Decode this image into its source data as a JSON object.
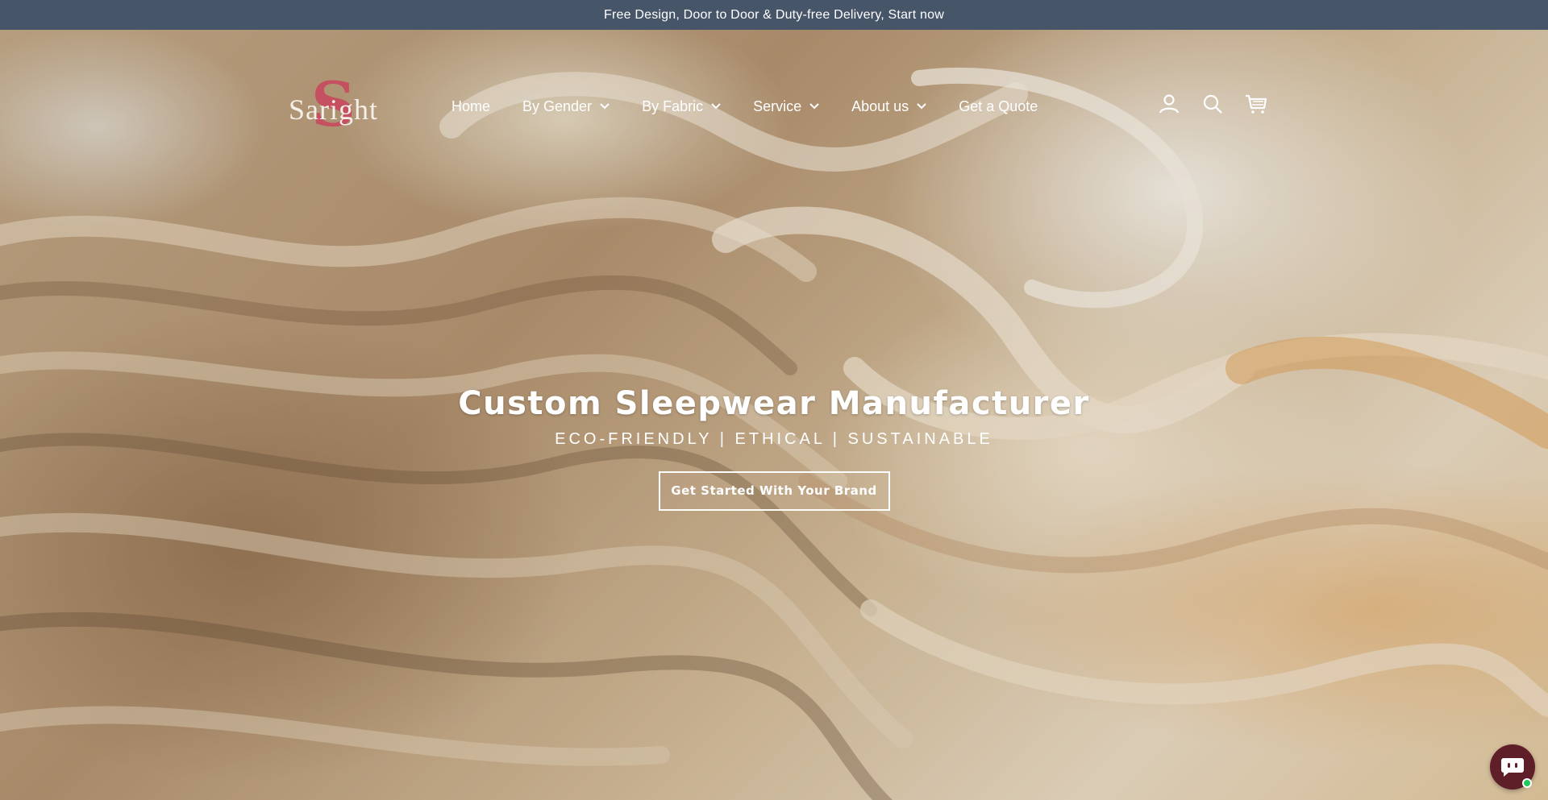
{
  "announcement": {
    "text": "Free Design, Door to Door & Duty-free Delivery, Start now"
  },
  "header": {
    "logo": {
      "text": "Saright",
      "icon": "saright-logo"
    },
    "nav": [
      {
        "label": "Home",
        "has_dropdown": false
      },
      {
        "label": "By Gender",
        "has_dropdown": true
      },
      {
        "label": "By Fabric",
        "has_dropdown": true
      },
      {
        "label": "Service",
        "has_dropdown": true
      },
      {
        "label": "About us",
        "has_dropdown": true
      },
      {
        "label": "Get a Quote",
        "has_dropdown": false
      }
    ],
    "icons": [
      "account-icon",
      "search-icon",
      "cart-icon"
    ]
  },
  "hero": {
    "title": "Custom Sleepwear Manufacturer",
    "subtitle": "ECO-FRIENDLY | ETHICAL | SUSTAINABLE",
    "cta_label": "Get Started With Your Brand"
  },
  "chat": {
    "icon": "chat-bubble-icon",
    "status_color": "#22c55e"
  },
  "colors": {
    "announcement_bg": "#475569",
    "logo_accent": "#c8495f",
    "chat_bg": "#5e1f28"
  }
}
